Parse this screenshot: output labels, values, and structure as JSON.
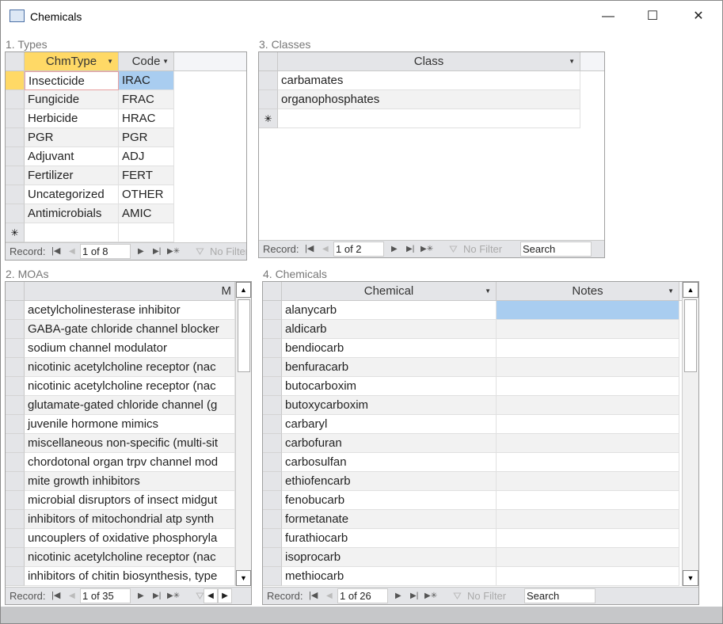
{
  "window": {
    "title": "Chemicals",
    "minimize": "—",
    "maximize": "☐",
    "close": "✕"
  },
  "types": {
    "label": "1. Types",
    "headers": [
      "ChmType",
      "Code"
    ],
    "rows": [
      [
        "Insecticide",
        "IRAC"
      ],
      [
        "Fungicide",
        "FRAC"
      ],
      [
        "Herbicide",
        "HRAC"
      ],
      [
        "PGR",
        "PGR"
      ],
      [
        "Adjuvant",
        "ADJ"
      ],
      [
        "Fertilizer",
        "FERT"
      ],
      [
        "Uncategorized",
        "OTHER"
      ],
      [
        "Antimicrobials",
        "AMIC"
      ]
    ],
    "nav": {
      "record_label": "Record:",
      "position": "1 of 8",
      "filter": "No Filter"
    }
  },
  "classes": {
    "label": "3. Classes",
    "headers": [
      "Class"
    ],
    "rows": [
      [
        "carbamates"
      ],
      [
        "organophosphates"
      ]
    ],
    "nav": {
      "record_label": "Record:",
      "position": "1 of 2",
      "filter": "No Filter",
      "search": "Search"
    }
  },
  "moas": {
    "label": "2. MOAs",
    "headers": [
      "M"
    ],
    "rows": [
      [
        "acetylcholinesterase inhibitor"
      ],
      [
        "GABA-gate chloride channel blocker"
      ],
      [
        "sodium channel modulator"
      ],
      [
        "nicotinic acetylcholine receptor (nac"
      ],
      [
        "nicotinic acetylcholine receptor (nac"
      ],
      [
        "glutamate-gated chloride channel (g"
      ],
      [
        "juvenile hormone mimics"
      ],
      [
        "miscellaneous non-specific (multi-sit"
      ],
      [
        "chordotonal organ trpv channel mod"
      ],
      [
        "mite growth inhibitors"
      ],
      [
        "microbial disruptors of insect midgut"
      ],
      [
        "inhibitors of mitochondrial atp synth"
      ],
      [
        "uncouplers of oxidative phosphoryla"
      ],
      [
        "nicotinic acetylcholine receptor (nac"
      ],
      [
        "inhibitors of chitin biosynthesis, type"
      ]
    ],
    "nav": {
      "record_label": "Record:",
      "position": "1 of 35"
    }
  },
  "chemicals": {
    "label": "4. Chemicals",
    "headers": [
      "Chemical",
      "Notes"
    ],
    "rows": [
      [
        "alanycarb",
        ""
      ],
      [
        "aldicarb",
        ""
      ],
      [
        "bendiocarb",
        ""
      ],
      [
        "benfuracarb",
        ""
      ],
      [
        "butocarboxim",
        ""
      ],
      [
        "butoxycarboxim",
        ""
      ],
      [
        "carbaryl",
        ""
      ],
      [
        "carbofuran",
        ""
      ],
      [
        "carbosulfan",
        ""
      ],
      [
        "ethiofencarb",
        ""
      ],
      [
        "fenobucarb",
        ""
      ],
      [
        "formetanate",
        ""
      ],
      [
        "furathiocarb",
        ""
      ],
      [
        "isoprocarb",
        ""
      ],
      [
        "methiocarb",
        ""
      ]
    ],
    "nav": {
      "record_label": "Record:",
      "position": "1 of 26",
      "filter": "No Filter",
      "search": "Search"
    }
  },
  "colors": {
    "active_header": "#ffd966",
    "selected_cell": "#a9cdf0",
    "new_record_marker": "✳"
  }
}
